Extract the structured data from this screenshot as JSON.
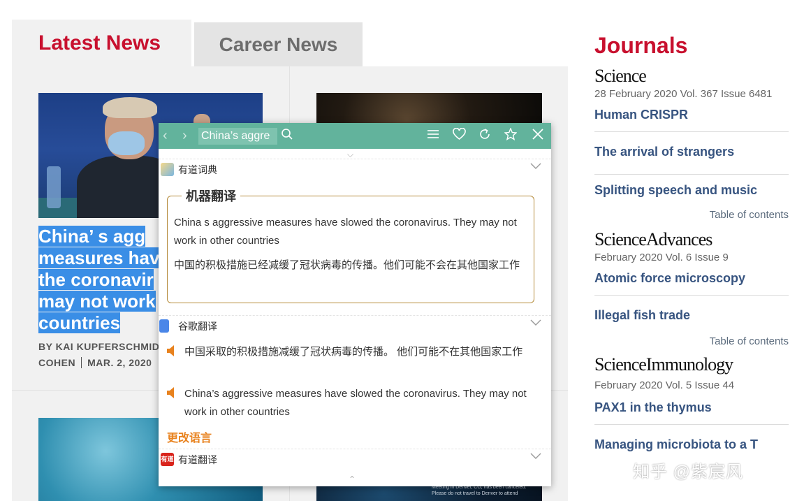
{
  "tabs": {
    "latest": "Latest News",
    "career": "Career News"
  },
  "article": {
    "headline_lines": [
      "China’ s agg",
      "measures hav",
      "the coronavir",
      "may not work",
      "countries"
    ],
    "byline_line1": "BY KAI KUPFERSCHMID",
    "byline_author2": "COHEN",
    "byline_date": "MAR. 2, 2020"
  },
  "image_d_notice": "Meeting in Denver, CO, has been canceled. Please do not travel to Denver to attend",
  "journals": {
    "title": "Journals",
    "science": {
      "name": "Science",
      "issue": "28 February 2020 Vol. 367 Issue 6481",
      "links": [
        "Human CRISPR",
        "The arrival of strangers",
        "Splitting speech and music"
      ],
      "toc": "Table of contents"
    },
    "advances": {
      "name": "ScienceAdvances",
      "issue": "February 2020 Vol. 6 Issue 9",
      "links": [
        "Atomic force microscopy",
        "Illegal fish trade"
      ],
      "toc": "Table of contents"
    },
    "immunology": {
      "name": "ScienceImmunology",
      "issue": "February 2020 Vol. 5 Issue 44",
      "links": [
        "PAX1 in the thymus",
        "Managing microbiota to a T"
      ]
    }
  },
  "popup": {
    "query": "China’s aggre",
    "youdao_dict_label": "有道词典",
    "machine_translation_title": "机器翻译",
    "mt_source": "China s aggressive measures have slowed the coronavirus. They may not work in other countries",
    "mt_target": "中国的积极措施已经减缓了冠状病毒的传播。他们可能不会在其他国家工作",
    "google_label": "谷歌翻译",
    "google_zh": "中国采取的积极措施减缓了冠状病毒的传播。 他们可能不在其他国家工作",
    "google_en": "China’s aggressive measures have slowed the coronavirus. They may not work in other countries",
    "change_language": "更改语言",
    "youdao_translate_label": "有道翻译",
    "youdao_logo_text": "有道"
  },
  "watermark": "知乎 @紫宸风",
  "colors": {
    "brand_red": "#c8102e",
    "link_blue": "#375480",
    "popup_green": "#62b39c",
    "highlight": "#3a8ee6",
    "accent_orange": "#e8821e"
  }
}
